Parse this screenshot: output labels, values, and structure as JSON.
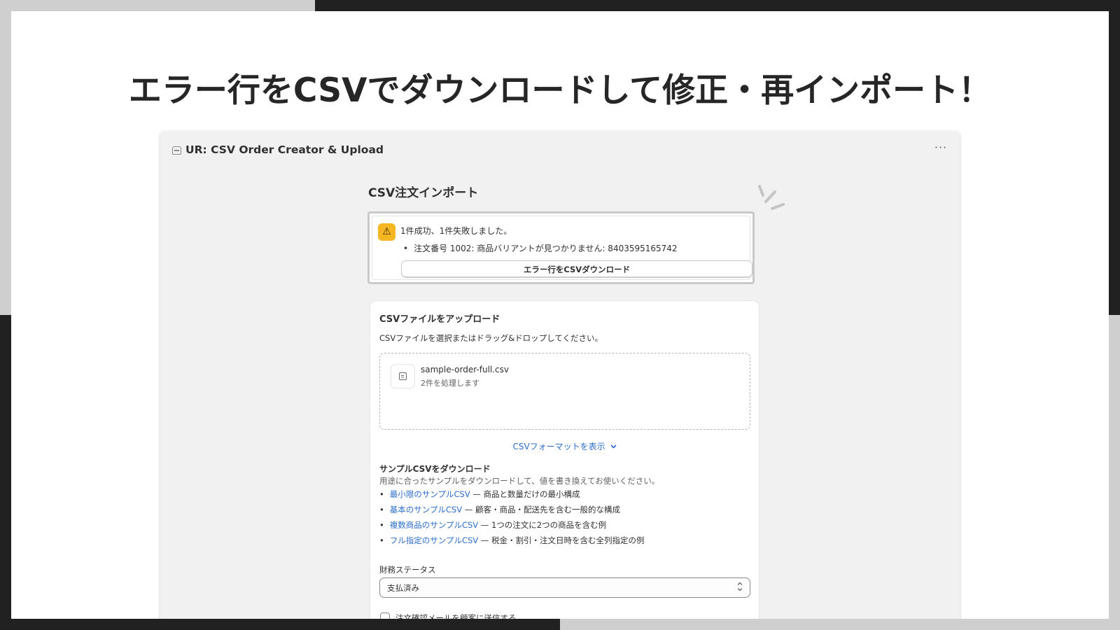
{
  "slide": {
    "title": "エラー行をCSVでダウンロードして修正・再インポート！"
  },
  "window": {
    "app_title": "UR: CSV Order Creator & Upload",
    "more_label": "···",
    "page_heading": "CSV注文インポート"
  },
  "banner": {
    "status": "warning",
    "icon": "warning-triangle-icon",
    "accent_color": "#f5b623",
    "message": "1件成功、1件失敗しました。",
    "errors": [
      "注文番号 1002: 商品バリアントが見つかりません: 8403595165742"
    ],
    "download_button": "エラー行をCSVダウンロード"
  },
  "upload": {
    "heading": "CSVファイルをアップロード",
    "description": "CSVファイルを選択またはドラッグ&ドロップしてください。",
    "file_icon": "file-icon",
    "file_name": "sample-order-full.csv",
    "file_info": "2件を処理します",
    "format_toggle": "CSVフォーマットを表示"
  },
  "samples": {
    "heading": "サンプルCSVをダウンロード",
    "description": "用途に合ったサンプルをダウンロードして、値を書き換えてお使いください。",
    "items": [
      {
        "link": "最小限のサンプルCSV",
        "text": " — 商品と数量だけの最小構成"
      },
      {
        "link": "基本のサンプルCSV",
        "text": " — 顧客・商品・配送先を含む一般的な構成"
      },
      {
        "link": "複数商品のサンプルCSV",
        "text": " — 1つの注文に2つの商品を含む例"
      },
      {
        "link": "フル指定のサンプルCSV",
        "text": " — 税金・割引・注文日時を含む全列指定の例"
      }
    ]
  },
  "financial_status": {
    "label": "財務ステータス",
    "selected": "支払済み"
  },
  "notify": {
    "label": "注文確認メールを顧客に送信する",
    "checked": false
  },
  "colors": {
    "link": "#2c6ecb",
    "frame_dark": "#212121",
    "frame_light": "#cfcfcf"
  }
}
